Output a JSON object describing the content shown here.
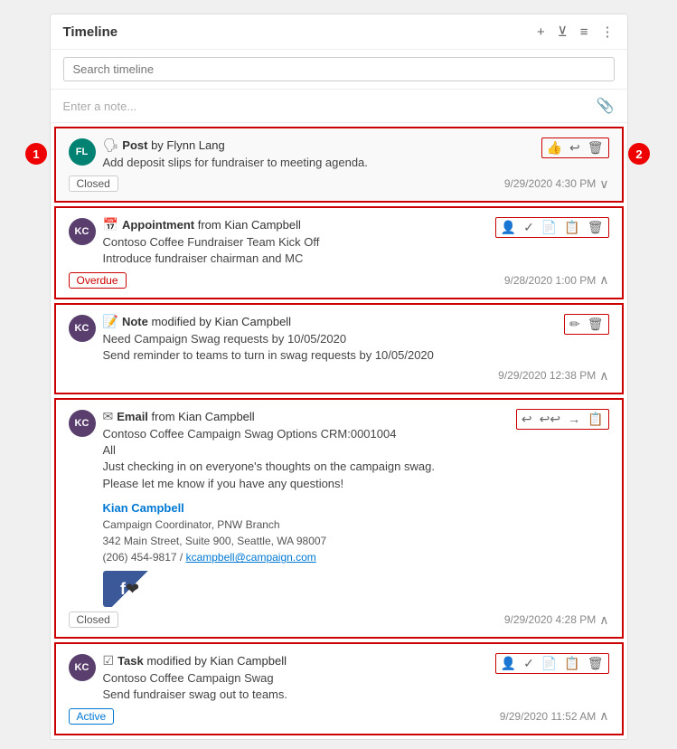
{
  "panel": {
    "title": "Timeline",
    "search_placeholder": "Search timeline",
    "note_placeholder": "Enter a note..."
  },
  "header_icons": [
    "+",
    "⊻",
    "≡",
    "⋮"
  ],
  "items": [
    {
      "id": "post-1",
      "type": "post",
      "type_icon": "🗣",
      "avatar_initials": "FL",
      "avatar_class": "avatar-fl",
      "title_prefix": "Post",
      "title_author": "Flynn Lang",
      "body_lines": [
        "Add deposit slips for fundraiser to meeting agenda."
      ],
      "status": "Closed",
      "status_class": "",
      "timestamp": "9/29/2020 4:30 PM",
      "actions": [
        "👍",
        "↩",
        "🗑"
      ],
      "chevron": "∨",
      "highlighted": true
    },
    {
      "id": "appointment-1",
      "type": "appointment",
      "type_icon": "📅",
      "avatar_initials": "KC",
      "avatar_class": "avatar-kc",
      "title_prefix": "Appointment",
      "title_author": "Kian Campbell",
      "body_lines": [
        "Contoso Coffee Fundraiser Team Kick Off",
        "Introduce fundraiser chairman and MC"
      ],
      "status": "Overdue",
      "status_class": "overdue",
      "timestamp": "9/28/2020 1:00 PM",
      "actions": [
        "👤",
        "✓",
        "📄",
        "📋",
        "🗑"
      ],
      "chevron": "∧"
    },
    {
      "id": "note-1",
      "type": "note",
      "type_icon": "📝",
      "avatar_initials": "KC",
      "avatar_class": "avatar-kc",
      "title_prefix": "Note",
      "title_author": "Kian Campbell",
      "body_lines": [
        "Need Campaign Swag requests by 10/05/2020",
        "Send reminder to teams to turn in swag requests by 10/05/2020"
      ],
      "status": null,
      "status_class": "",
      "timestamp": "9/29/2020 12:38 PM",
      "actions": [
        "✏",
        "🗑"
      ],
      "chevron": "∧"
    },
    {
      "id": "email-1",
      "type": "email",
      "type_icon": "✉",
      "avatar_initials": "KC",
      "avatar_class": "avatar-kc",
      "title_prefix": "Email",
      "title_author": "Kian Campbell",
      "body_lines": [
        "Contoso Coffee Campaign Swag Options CRM:0001004",
        "All",
        "Just checking in on everyone's thoughts on the campaign swag.",
        "Please let me know if you have any questions!"
      ],
      "signature": {
        "name": "Kian Campbell",
        "role": "Campaign Coordinator, PNW Branch",
        "address": "342 Main Street, Suite 900, Seattle, WA 98007",
        "phone_email": "(206) 454-9817 / kcampbell@campaign.com"
      },
      "status": "Closed",
      "status_class": "",
      "timestamp": "9/29/2020 4:28 PM",
      "actions": [
        "↩",
        "↩↩",
        "→",
        "📋"
      ],
      "chevron": "∧"
    },
    {
      "id": "task-1",
      "type": "task",
      "type_icon": "☑",
      "avatar_initials": "KC",
      "avatar_class": "avatar-kc",
      "title_prefix": "Task",
      "title_author": "Kian Campbell",
      "body_lines": [
        "Contoso Coffee Campaign Swag",
        "Send fundraiser swag out to teams."
      ],
      "status": "Active",
      "status_class": "active",
      "timestamp": "9/29/2020 11:52 AM",
      "actions": [
        "👤",
        "✓",
        "📄",
        "📋",
        "🗑"
      ],
      "chevron": "∧"
    }
  ],
  "annotations": {
    "circle1_label": "1",
    "circle2_label": "2"
  }
}
